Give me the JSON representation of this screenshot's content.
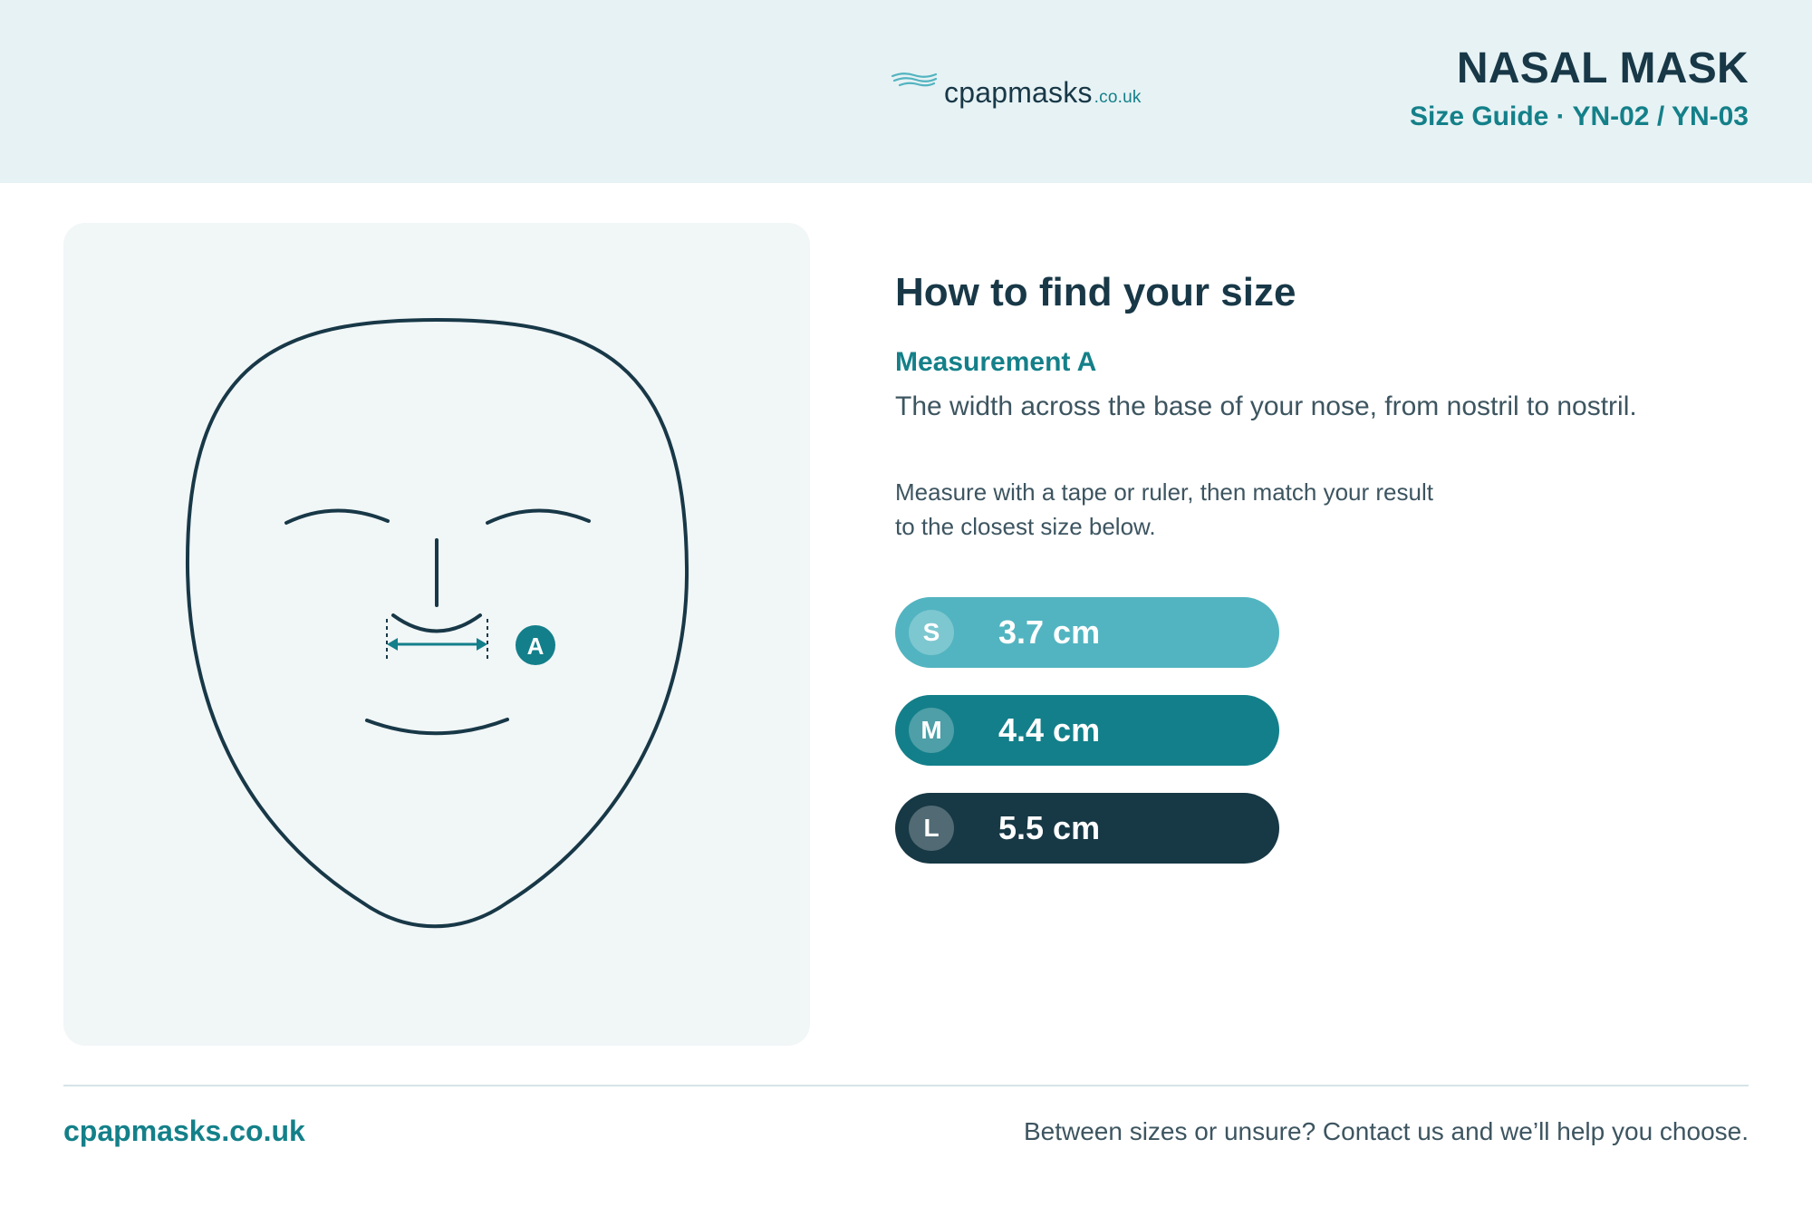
{
  "header": {
    "logo_text": "cpapmasks",
    "logo_suffix": ".co.uk",
    "title": "NASAL MASK",
    "subtitle": "Size Guide · YN-02 / YN-03"
  },
  "illustration": {
    "marker_label": "A"
  },
  "guide": {
    "title": "How to find your size",
    "measurement_label": "Measurement A",
    "measurement_description": "The width across the base of your nose, from nostril to nostril.",
    "instructions_line1": "Measure with a tape or ruler, then match your result",
    "instructions_line2": "to the closest size below."
  },
  "sizes": [
    {
      "code": "S",
      "value": "3.7 cm",
      "color": "#52b4c0"
    },
    {
      "code": "M",
      "value": "4.4 cm",
      "color": "#137f8a"
    },
    {
      "code": "L",
      "value": "5.5 cm",
      "color": "#173845"
    }
  ],
  "footer": {
    "brand": "cpapmasks.co.uk",
    "note": "Between sizes or unsure? Contact us and we’ll help you choose."
  },
  "colors": {
    "header_bg": "#e7f2f4",
    "accent": "#137f8a",
    "dark": "#183847"
  }
}
